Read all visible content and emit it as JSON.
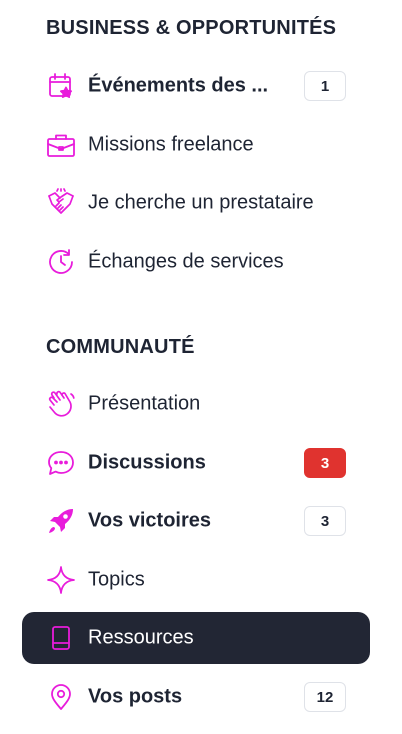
{
  "colors": {
    "accent": "#e81cdb",
    "active_bg": "#222634",
    "text": "#1e2433",
    "badge_alert": "#e0332f"
  },
  "sections": [
    {
      "title": "BUSINESS & OPPORTUNITÉS",
      "items": [
        {
          "label": "Événements des ...",
          "icon": "calendar-star-icon",
          "badge": "1"
        },
        {
          "label": "Missions freelance",
          "icon": "briefcase-icon"
        },
        {
          "label": "Je cherche un prestataire",
          "icon": "handshake-icon"
        },
        {
          "label": "Échanges de services",
          "icon": "clock-refresh-icon"
        }
      ]
    },
    {
      "title": "COMMUNAUTÉ",
      "items": [
        {
          "label": "Présentation",
          "icon": "waving-hand-icon"
        },
        {
          "label": "Discussions",
          "icon": "chat-bubble-icon",
          "badge": "3"
        },
        {
          "label": "Vos victoires",
          "icon": "rocket-icon",
          "badge": "3"
        },
        {
          "label": "Topics",
          "icon": "sparkle-icon"
        },
        {
          "label": "Ressources",
          "icon": "book-icon",
          "active": true
        },
        {
          "label": "Vos posts",
          "icon": "map-pin-icon",
          "badge": "12"
        }
      ]
    }
  ]
}
